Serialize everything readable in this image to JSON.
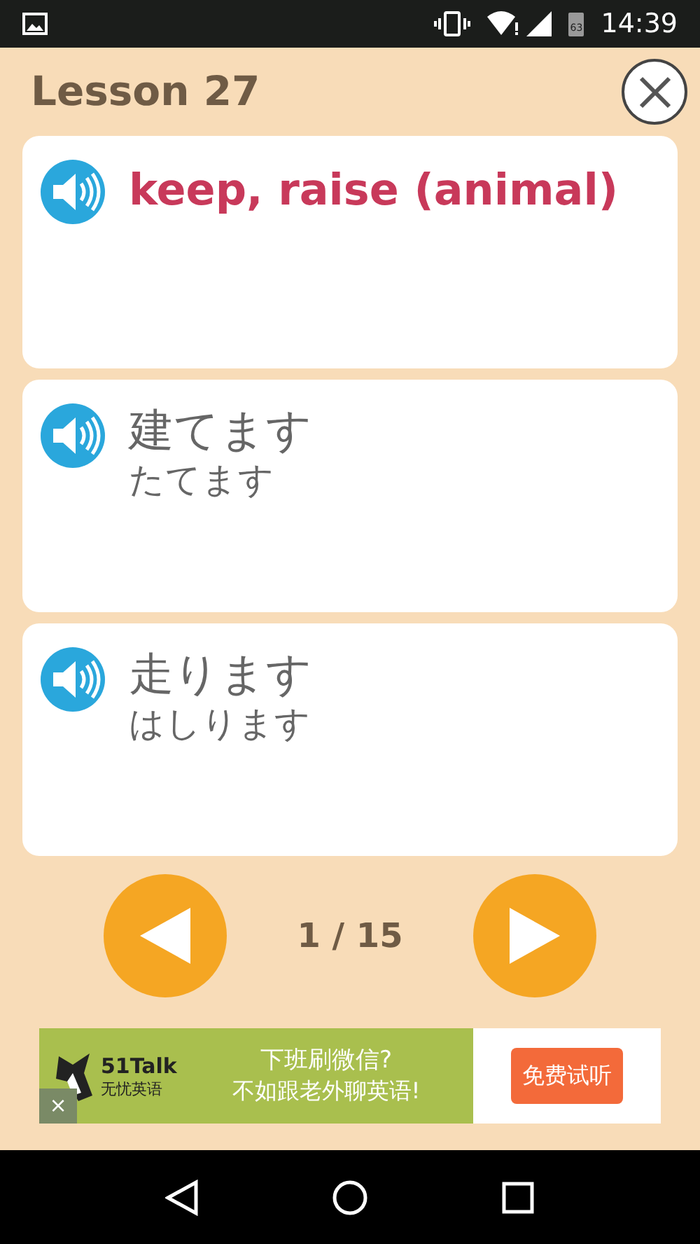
{
  "status_bar": {
    "battery": "63",
    "time": "14:39"
  },
  "header": {
    "title": "Lesson 27"
  },
  "cards": [
    {
      "kind": "meaning",
      "text": "keep, raise (animal)"
    },
    {
      "kind": "word",
      "text": "建てます",
      "reading": "たてます"
    },
    {
      "kind": "word",
      "text": "走ります",
      "reading": "はしります"
    }
  ],
  "pager": {
    "text": "1 / 15"
  },
  "ad": {
    "brand": "51Talk",
    "brand_sub": "无忧英语",
    "line_1": "下班刷微信?",
    "line_2": "不如跟老外聊英语!",
    "button": "免费试听",
    "close": "×"
  }
}
